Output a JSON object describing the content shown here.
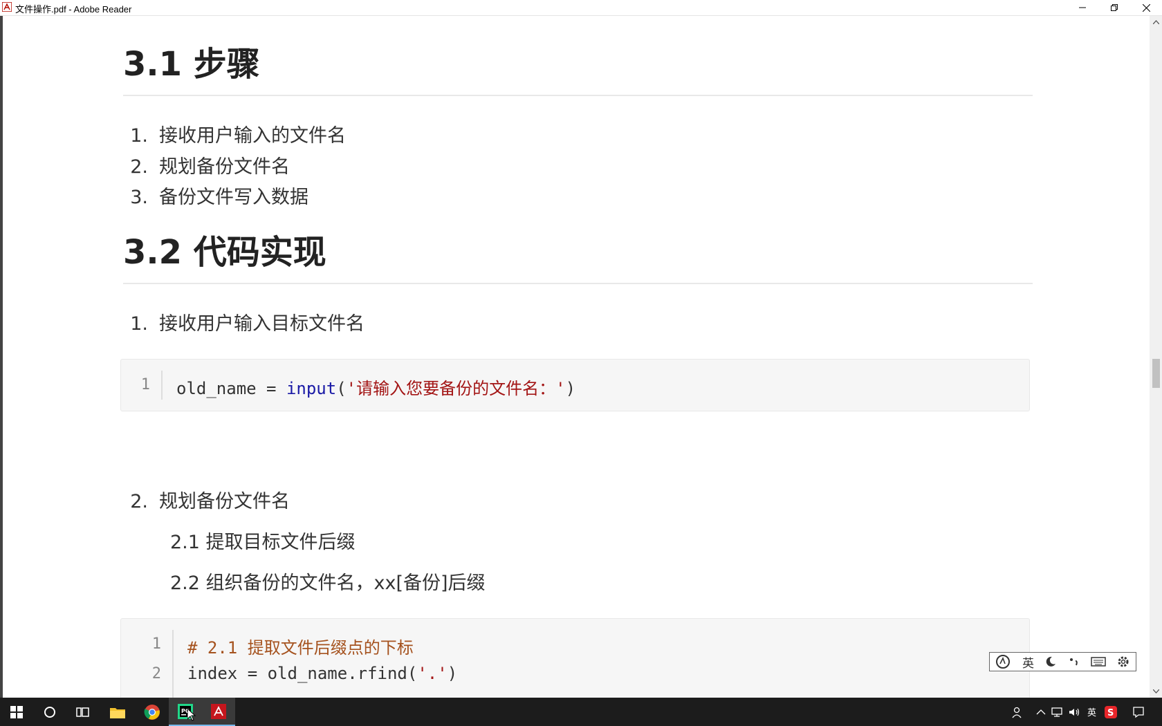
{
  "window": {
    "title": "文件操作.pdf - Adobe Reader"
  },
  "doc": {
    "heading1": "3.1 步骤",
    "steps": [
      {
        "num": "1.",
        "text": "接收用户输入的文件名"
      },
      {
        "num": "2.",
        "text": "规划备份文件名"
      },
      {
        "num": "3.",
        "text": "备份文件写入数据"
      }
    ],
    "heading2": "3.2 代码实现",
    "item1": {
      "num": "1.",
      "text": "接收用户输入目标文件名"
    },
    "code1": {
      "lineno": "1",
      "var": "old_name = ",
      "func": "input",
      "open": "(",
      "str": "'请输入您要备份的文件名：'",
      "close": ")"
    },
    "item2": {
      "num": "2.",
      "text": "规划备份文件名"
    },
    "sub1": "2.1 提取目标文件后缀",
    "sub2": "2.2 组织备份的文件名，xx[备份]后缀",
    "code2": {
      "lines": [
        {
          "lineno": "1",
          "comment": "# 2.1 提取文件后缀点的下标"
        },
        {
          "lineno": "2",
          "pre": "index = old_name.rfind(",
          "str": "'.'",
          "post": ")"
        }
      ]
    }
  },
  "ime": {
    "lang": "英"
  },
  "tray": {
    "lang": "英"
  }
}
